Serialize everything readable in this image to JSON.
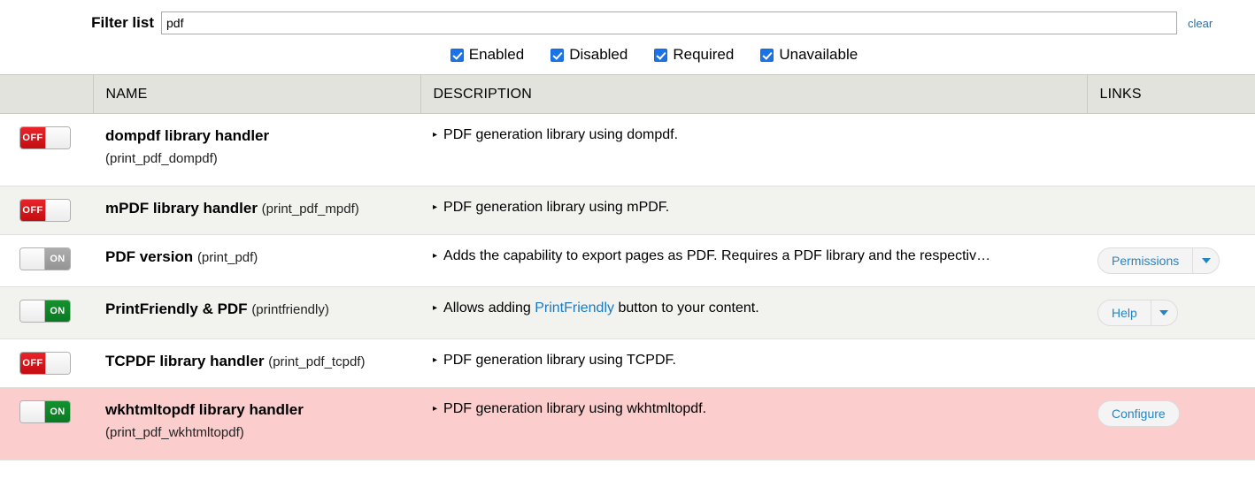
{
  "filter": {
    "label": "Filter list",
    "value": "pdf",
    "placeholder": "",
    "clear_label": "clear"
  },
  "status_filters": [
    {
      "label": "Enabled",
      "checked": true
    },
    {
      "label": "Disabled",
      "checked": true
    },
    {
      "label": "Required",
      "checked": true
    },
    {
      "label": "Unavailable",
      "checked": true
    }
  ],
  "table": {
    "headers": {
      "toggle": "",
      "name": "NAME",
      "description": "DESCRIPTION",
      "links": "LINKS"
    },
    "rows": [
      {
        "toggle_state": "OFF",
        "name": "dompdf library handler",
        "key": "(print_pdf_dompdf)",
        "key_inline": false,
        "description": "PDF generation library using dompdf.",
        "link_label": "",
        "link_has_caret": false
      },
      {
        "toggle_state": "OFF",
        "name": "mPDF library handler",
        "key": "(print_pdf_mpdf)",
        "key_inline": true,
        "description": "PDF generation library using mPDF.",
        "link_label": "",
        "link_has_caret": false
      },
      {
        "toggle_state": "ON",
        "name": "PDF version",
        "key": "(print_pdf)",
        "key_inline": true,
        "description": "Adds the capability to export pages as PDF. Requires a PDF library and the respectiv…",
        "link_label": "Permissions",
        "link_has_caret": true
      },
      {
        "toggle_state": "ON",
        "name": "PrintFriendly & PDF",
        "key": "(printfriendly)",
        "key_inline": true,
        "description_prefix": "Allows adding ",
        "description_link": "PrintFriendly",
        "description_suffix": " button to your content.",
        "link_label": "Help",
        "link_has_caret": true
      },
      {
        "toggle_state": "OFF",
        "name": "TCPDF library handler",
        "key": "(print_pdf_tcpdf)",
        "key_inline": true,
        "description": "PDF generation library using TCPDF.",
        "link_label": "",
        "link_has_caret": false
      },
      {
        "toggle_state": "ON",
        "name": "wkhtmltopdf library handler",
        "key": "(print_pdf_wkhtmltopdf)",
        "key_inline": false,
        "description": "PDF generation library using wkhtmltopdf.",
        "link_label": "Configure",
        "link_has_caret": false
      }
    ]
  },
  "colors": {
    "toggle_off": "#c40d12",
    "toggle_on": "#0a7a22",
    "toggle_muted": "#949494",
    "link_blue": "#2585c4",
    "checkbox_blue": "#1a73e8",
    "header_bg": "#e3e3de",
    "stripe_bg": "#f2f2ef",
    "danger_bg": "#fbcdcd"
  }
}
